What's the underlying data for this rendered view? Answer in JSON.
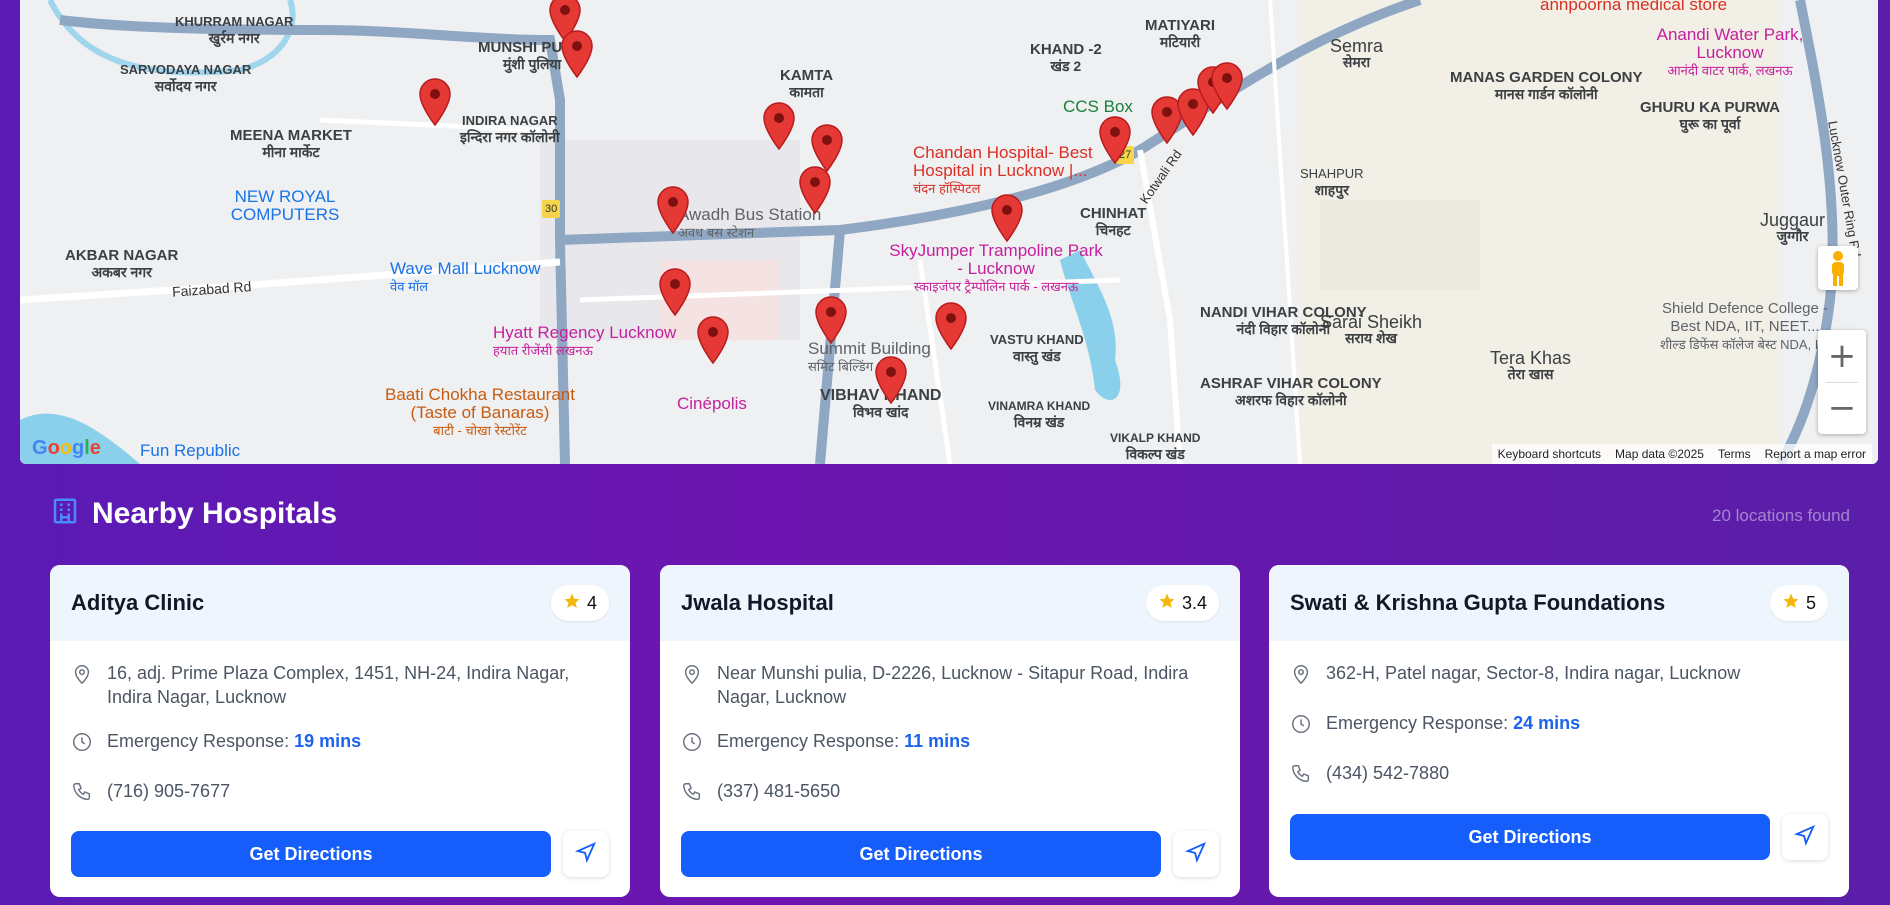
{
  "map": {
    "areas": [
      {
        "en": "KHURRAM NAGAR",
        "hi": "खुर्रम नगर"
      },
      {
        "en": "SARVODAYA NAGAR",
        "hi": "सर्वोदय नगर"
      },
      {
        "en": "MUNSHI PULIA",
        "hi": "मुंशी पुलिया"
      },
      {
        "en": "KAMTA",
        "hi": "कामता"
      },
      {
        "en": "KHAND -2",
        "hi": "खंड 2"
      },
      {
        "en": "MATIYARI",
        "hi": "मटियारी"
      },
      {
        "en": "Semra",
        "hi": "सेमरा"
      },
      {
        "en": "MANAS GARDEN COLONY",
        "hi": "मानस गार्डन कॉलोनी"
      },
      {
        "en": "GHURU KA PURWA",
        "hi": "घुरू का पूर्वा"
      },
      {
        "en": "MEENA MARKET",
        "hi": "मीना मार्केट"
      },
      {
        "en": "INDIRA NAGAR",
        "hi": "इन्दिरा नगर कॉलोनी"
      },
      {
        "en": "CHINHAT",
        "hi": "चिनहट"
      },
      {
        "en": "SHAHPUR",
        "hi": "शाहपुर"
      },
      {
        "en": "Juggaur",
        "hi": "जुग्गौर"
      },
      {
        "en": "AKBAR NAGAR",
        "hi": "अकबर नगर"
      },
      {
        "en": "NANDI VIHAR COLONY",
        "hi": "नंदी विहार कॉलोनी"
      },
      {
        "en": "Sarai Sheikh",
        "hi": "सराय शेख"
      },
      {
        "en": "Tera Khas",
        "hi": "तेरा खास"
      },
      {
        "en": "VASTU KHAND",
        "hi": "वास्तु खंड"
      },
      {
        "en": "ASHRAF VIHAR COLONY",
        "hi": "अशरफ विहार कॉलोनी"
      },
      {
        "en": "VIBHAV KHAND",
        "hi": "विभव खांद"
      },
      {
        "en": "VINAMRA KHAND",
        "hi": "विनम्र खंड"
      },
      {
        "en": "VIKALP KHAND",
        "hi": "विकल्प खंड"
      }
    ],
    "pois": [
      {
        "text": "NEW ROYAL COMPUTERS",
        "color": "blue"
      },
      {
        "text": "Awadh Bus Station",
        "sub": "अवध बस स्टेशन",
        "color": "gray"
      },
      {
        "text": "Wave Mall Lucknow",
        "sub": "वेव मॉल",
        "color": "blue"
      },
      {
        "text": "Chandan Hospital- Best Hospital in Lucknow |...",
        "sub": "चंदन हॉस्पिटल",
        "color": "red"
      },
      {
        "text": "CCS Box",
        "color": "green"
      },
      {
        "text": "SkyJumper Trampoline Park - Lucknow",
        "sub": "स्काइजंपर ट्रैम्पोलिन पार्क - लखनऊ",
        "color": "pink"
      },
      {
        "text": "Hyatt Regency Lucknow",
        "sub": "हयात रीजेंसी लखनऊ",
        "color": "pink"
      },
      {
        "text": "Summit Building",
        "sub": "समिट बिल्डिंग",
        "color": "gray"
      },
      {
        "text": "Baati Chokha Restaurant (Taste of Banaras)",
        "sub": "बाटी - चोखा रेस्टोरेंट",
        "color": "orange"
      },
      {
        "text": "Cinépolis",
        "color": "pink"
      },
      {
        "text": "Fun Republic",
        "color": "blue"
      },
      {
        "text": "Anandi Water Park, Lucknow",
        "sub": "आनंदी वाटर पार्क, लखनऊ",
        "color": "pink"
      },
      {
        "text": "Shield Defence College - Best NDA, IIT, NEET...",
        "sub": "शील्ड डिफेंस कॉलेज बेस्ट NDA, IIT",
        "color": "gray"
      },
      {
        "text": "annpoorna medical store",
        "color": "red"
      }
    ],
    "roads": [
      "Faizabad Rd",
      "Kotwali Rd",
      "Lucknow Outer Ring Rd",
      "30",
      "27"
    ],
    "footer": {
      "shortcuts": "Keyboard shortcuts",
      "map_data": "Map data ©2025",
      "terms": "Terms",
      "report": "Report a map error"
    },
    "zoom_in": "+",
    "zoom_out": "−"
  },
  "section": {
    "title": "Nearby Hospitals",
    "count_text": "20 locations found"
  },
  "hospitals": [
    {
      "name": "Aditya Clinic",
      "rating": "4",
      "address": "16, adj. Prime Plaza Complex, 1451, NH-24, Indira Nagar, Indira Nagar, Lucknow",
      "emergency_label": "Emergency Response:",
      "emergency_time": "19 mins",
      "phone": "(716) 905-7677",
      "button": "Get Directions"
    },
    {
      "name": "Jwala Hospital",
      "rating": "3.4",
      "address": "Near Munshi pulia, D-2226, Lucknow - Sitapur Road, Indira Nagar, Lucknow",
      "emergency_label": "Emergency Response:",
      "emergency_time": "11 mins",
      "phone": "(337) 481-5650",
      "button": "Get Directions"
    },
    {
      "name": "Swati & Krishna Gupta Foundations",
      "rating": "5",
      "address": "362-H, Patel nagar, Sector-8, Indira nagar, Lucknow",
      "emergency_label": "Emergency Response:",
      "emergency_time": "24 mins",
      "phone": "(434) 542-7880",
      "button": "Get Directions"
    }
  ],
  "colors": {
    "accent": "#155efc",
    "pin": "#e53935",
    "star": "#f5b70a"
  }
}
